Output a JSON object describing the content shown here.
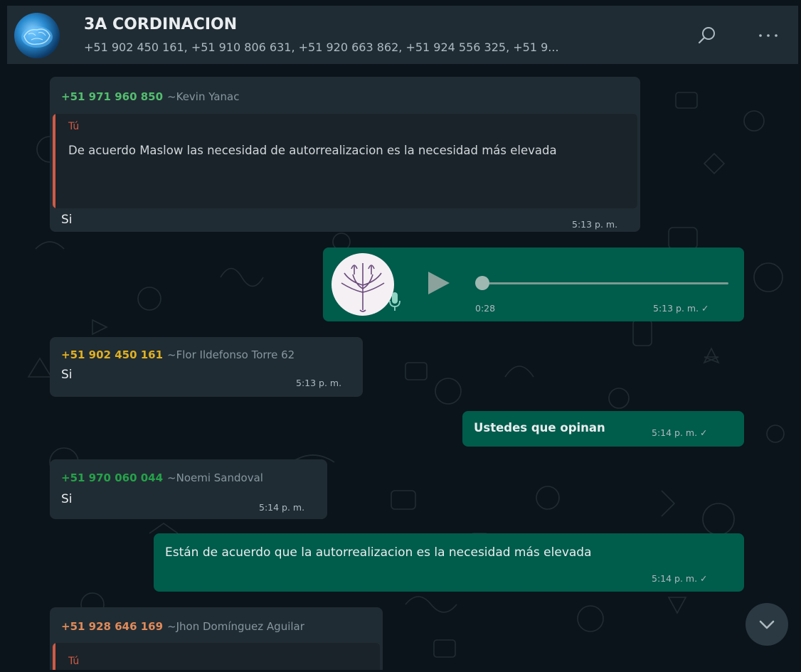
{
  "header": {
    "title": "3A CORDINACION",
    "participants": "+51 902 450 161, +51 910 806 631, +51 920 663 862, +51 924 556 325, +51 9...",
    "search_icon": "search-icon",
    "menu_icon": "more-options-icon"
  },
  "messages": [
    {
      "direction": "in",
      "sender_number": "+51 971 960 850",
      "sender_name": "~Kevin Yanac",
      "sender_color": "#53bd6f",
      "quote": {
        "author": "Tú",
        "text": "De acuerdo Maslow las necesidad de autorrealizacion es la necesidad más elevada"
      },
      "text": "Si",
      "time": "5:13 p. m."
    },
    {
      "direction": "out",
      "type": "voice",
      "duration": "0:28",
      "time": "5:13 p. m. ✓"
    },
    {
      "direction": "in",
      "sender_number": "+51 902 450 161",
      "sender_name": "~Flor Ildefonso Torre 62",
      "sender_color": "#e0b021",
      "text": "Si",
      "time": "5:13 p. m."
    },
    {
      "direction": "out",
      "text": "Ustedes que opinan",
      "time": "5:14 p. m. ✓"
    },
    {
      "direction": "in",
      "sender_number": "+51 970 060 044",
      "sender_name": "~Noemi Sandoval",
      "sender_color": "#25a24a",
      "text": "Si",
      "time": "5:14 p. m."
    },
    {
      "direction": "out",
      "text": "Están de acuerdo que la autorrealizacion es la necesidad más elevada",
      "time": "5:14 p. m. ✓"
    },
    {
      "direction": "in",
      "sender_number": "+51 928 646 169",
      "sender_name": "~Jhon Domínguez Aguilar",
      "sender_color": "#e08a5a",
      "quote": {
        "author": "Tú"
      }
    }
  ],
  "scroll_down_icon": "chevron-down-icon"
}
